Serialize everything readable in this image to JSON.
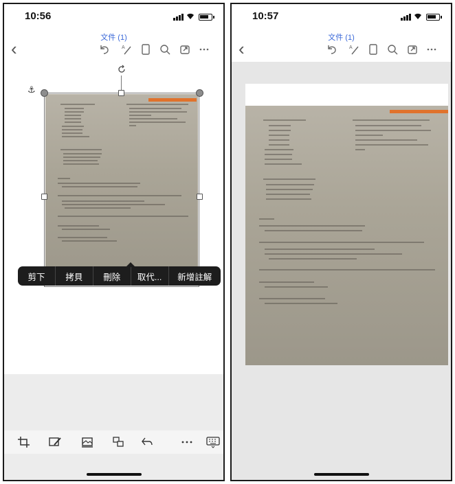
{
  "screens": [
    {
      "status": {
        "time": "10:56"
      },
      "title": "文件 (1)",
      "context_menu": [
        "剪下",
        "拷貝",
        "刪除",
        "取代...",
        "新增註解"
      ],
      "nav_icons": [
        "undo-icon",
        "pen-icon",
        "document-icon",
        "search-icon",
        "share-icon",
        "more-icon"
      ],
      "toolbar_icons": [
        "crop-icon",
        "markup-icon",
        "picture-style-icon",
        "arrange-icon",
        "undo-icon",
        "more-icon",
        "keyboard-icon"
      ]
    },
    {
      "status": {
        "time": "10:57"
      },
      "title": "文件 (1)",
      "nav_icons": [
        "undo-icon",
        "pen-icon",
        "document-icon",
        "search-icon",
        "share-icon",
        "more-icon"
      ]
    }
  ],
  "colors": {
    "accent": "#3a68d8",
    "ribbon": "#e0722c",
    "menu_bg": "#1d1d1d"
  }
}
